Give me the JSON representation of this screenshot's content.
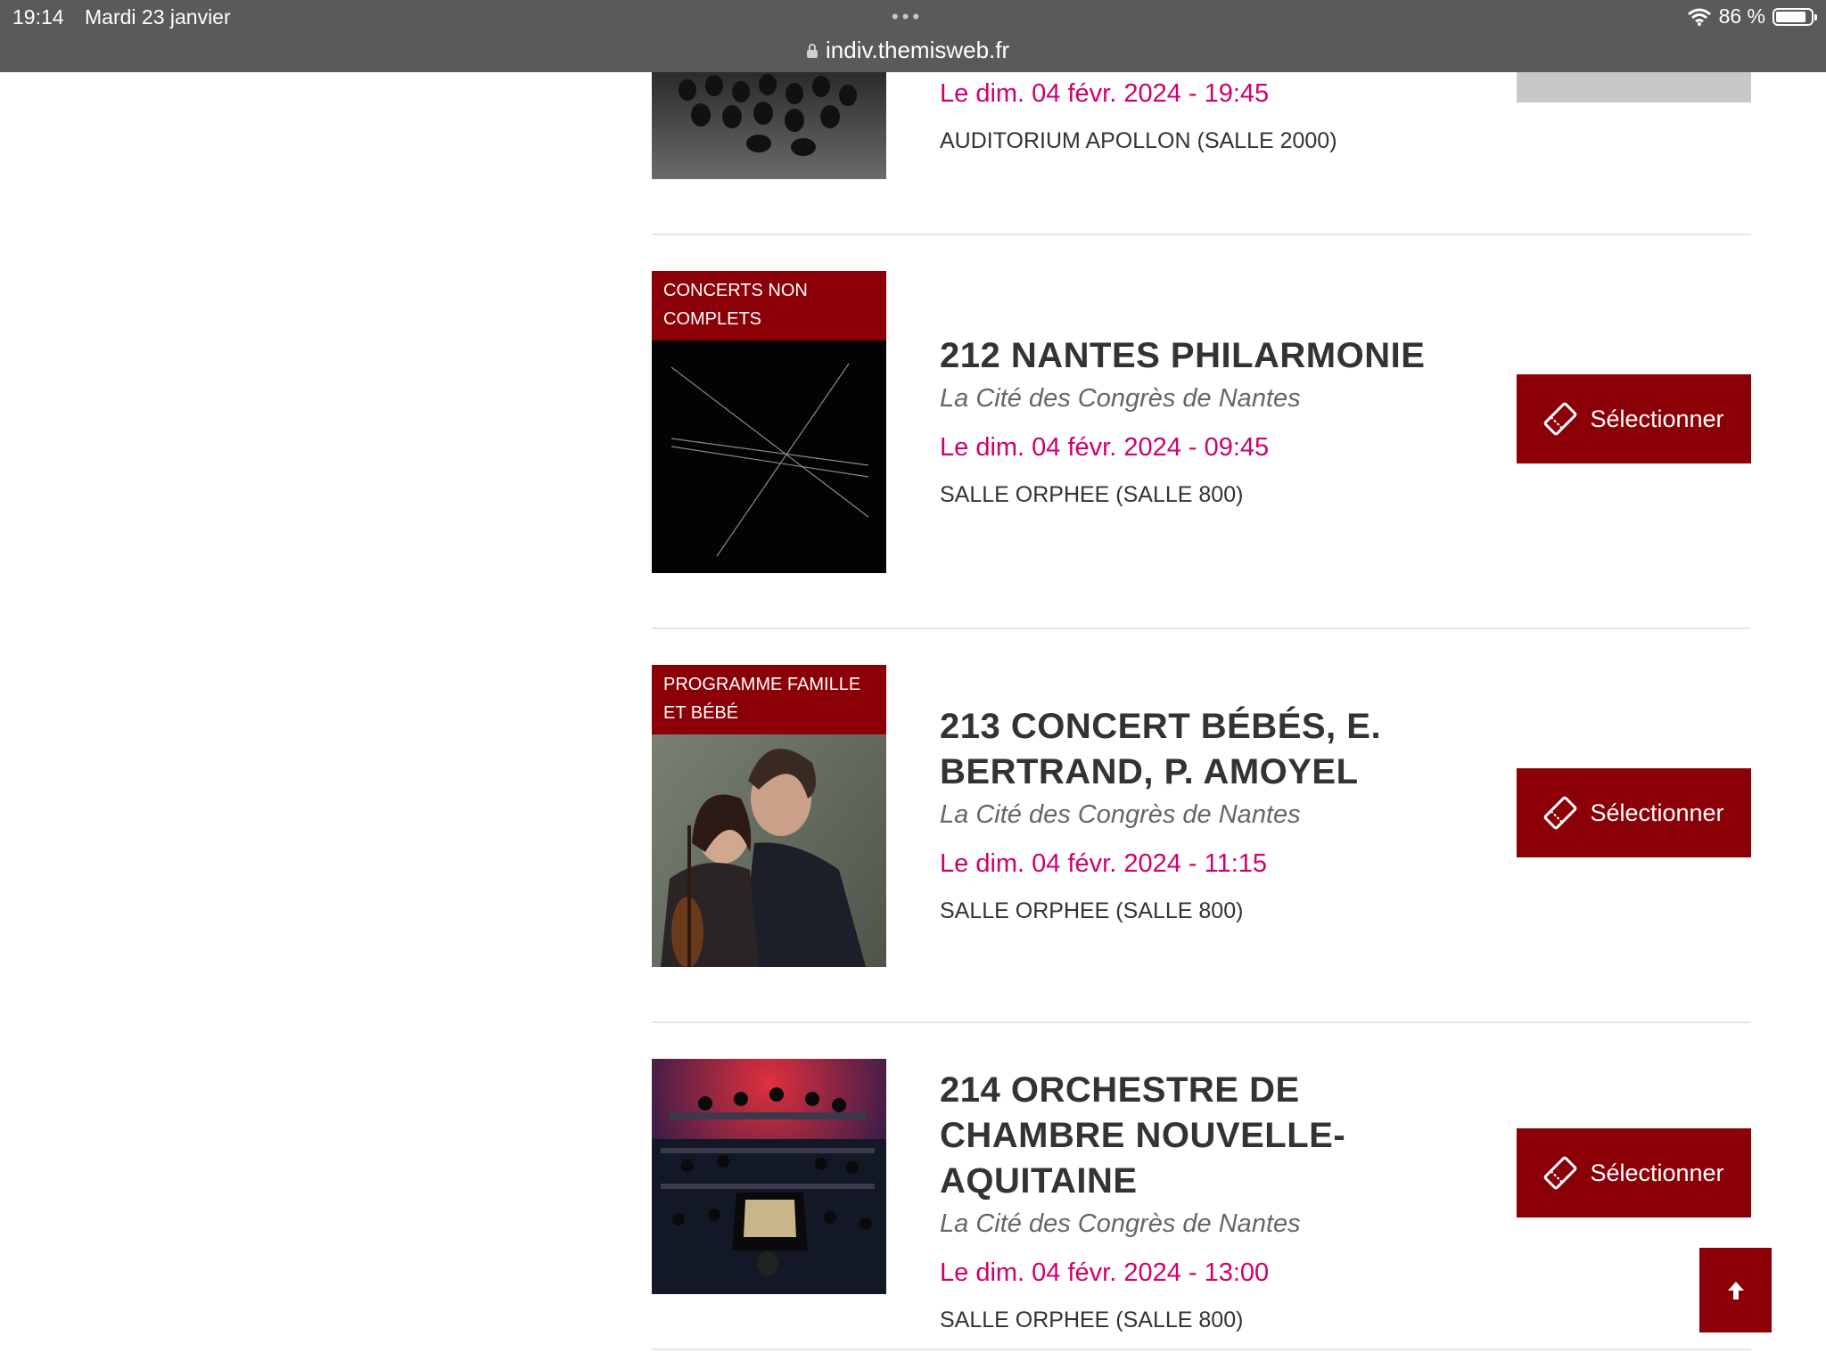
{
  "status_bar": {
    "time": "19:14",
    "date": "Mardi 23 janvier",
    "battery": "86 %",
    "battery_level": 0.86
  },
  "browser": {
    "url": "indiv.themisweb.fr"
  },
  "events": [
    {
      "date": "Le dim. 04 févr. 2024 - 19:45",
      "hall": "AUDITORIUM APOLLON (SALLE 2000)"
    },
    {
      "badge": "CONCERTS NON COMPLETS",
      "title": "212 NANTES PHILARMONIE",
      "venue": "La Cité des Congrès de Nantes",
      "date": "Le dim. 04 févr. 2024 - 09:45",
      "hall": "SALLE ORPHEE (SALLE 800)",
      "button": "Sélectionner"
    },
    {
      "badge": "PROGRAMME FAMILLE ET BÉBÉ",
      "title": "213 CONCERT BÉBÉS, E. BERTRAND, P. AMOYEL",
      "venue": "La Cité des Congrès de Nantes",
      "date": "Le dim. 04 févr. 2024 - 11:15",
      "hall": "SALLE ORPHEE (SALLE 800)",
      "button": "Sélectionner"
    },
    {
      "title": "214 ORCHESTRE DE CHAMBRE NOUVELLE-AQUITAINE",
      "venue": "La Cité des Congrès de Nantes",
      "date": "Le dim. 04 févr. 2024 - 13:00",
      "hall": "SALLE ORPHEE (SALLE 800)",
      "button": "Sélectionner"
    }
  ],
  "colors": {
    "accent": "#8b0007",
    "date": "#d1006b",
    "topbar": "#5a5a5a"
  },
  "icons": {
    "ticket": "ticket-icon",
    "scroll_top": "arrow-up-icon",
    "lock": "lock-icon",
    "wifi": "wifi-icon"
  }
}
